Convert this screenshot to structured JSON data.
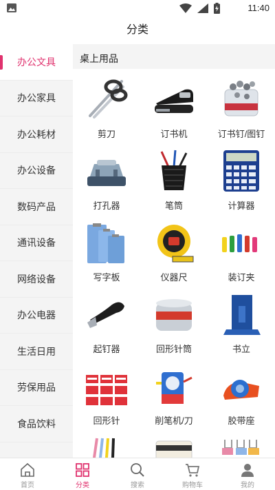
{
  "status_bar": {
    "time": "11:40"
  },
  "header": {
    "title": "分类"
  },
  "sidebar": {
    "items": [
      {
        "label": "办公文具",
        "active": true
      },
      {
        "label": "办公家具"
      },
      {
        "label": "办公耗材"
      },
      {
        "label": "办公设备"
      },
      {
        "label": "数码产品"
      },
      {
        "label": "通讯设备"
      },
      {
        "label": "网络设备"
      },
      {
        "label": "办公电器"
      },
      {
        "label": "生活日用"
      },
      {
        "label": "劳保用品"
      },
      {
        "label": "食品饮料"
      }
    ]
  },
  "content": {
    "section_title": "桌上用品",
    "products": [
      {
        "label": "剪刀",
        "icon": "scissors-icon"
      },
      {
        "label": "订书机",
        "icon": "stapler-icon"
      },
      {
        "label": "订书钉/图钉",
        "icon": "staples-icon"
      },
      {
        "label": "打孔器",
        "icon": "hole-punch-icon"
      },
      {
        "label": "笔筒",
        "icon": "pen-holder-icon"
      },
      {
        "label": "计算器",
        "icon": "calculator-icon"
      },
      {
        "label": "写字板",
        "icon": "clipboard-icon"
      },
      {
        "label": "仪器尺",
        "icon": "tape-measure-icon"
      },
      {
        "label": "装订夹",
        "icon": "binder-clips-icon"
      },
      {
        "label": "起钉器",
        "icon": "staple-remover-icon"
      },
      {
        "label": "回形针筒",
        "icon": "paperclip-tub-icon"
      },
      {
        "label": "书立",
        "icon": "bookend-icon"
      },
      {
        "label": "回形针",
        "icon": "paperclip-boxes-icon"
      },
      {
        "label": "削笔机/刀",
        "icon": "pencil-sharpener-icon"
      },
      {
        "label": "胶带座",
        "icon": "tape-dispenser-icon"
      }
    ]
  },
  "tabbar": {
    "tabs": [
      {
        "label": "首页",
        "icon": "home-icon"
      },
      {
        "label": "分类",
        "icon": "category-icon",
        "active": true
      },
      {
        "label": "搜索",
        "icon": "search-icon"
      },
      {
        "label": "购物车",
        "icon": "cart-icon"
      },
      {
        "label": "我的",
        "icon": "user-icon"
      }
    ]
  },
  "colors": {
    "accent": "#e0326e",
    "sidebar_bg": "#f4f4f4",
    "inactive_text": "#999999"
  }
}
